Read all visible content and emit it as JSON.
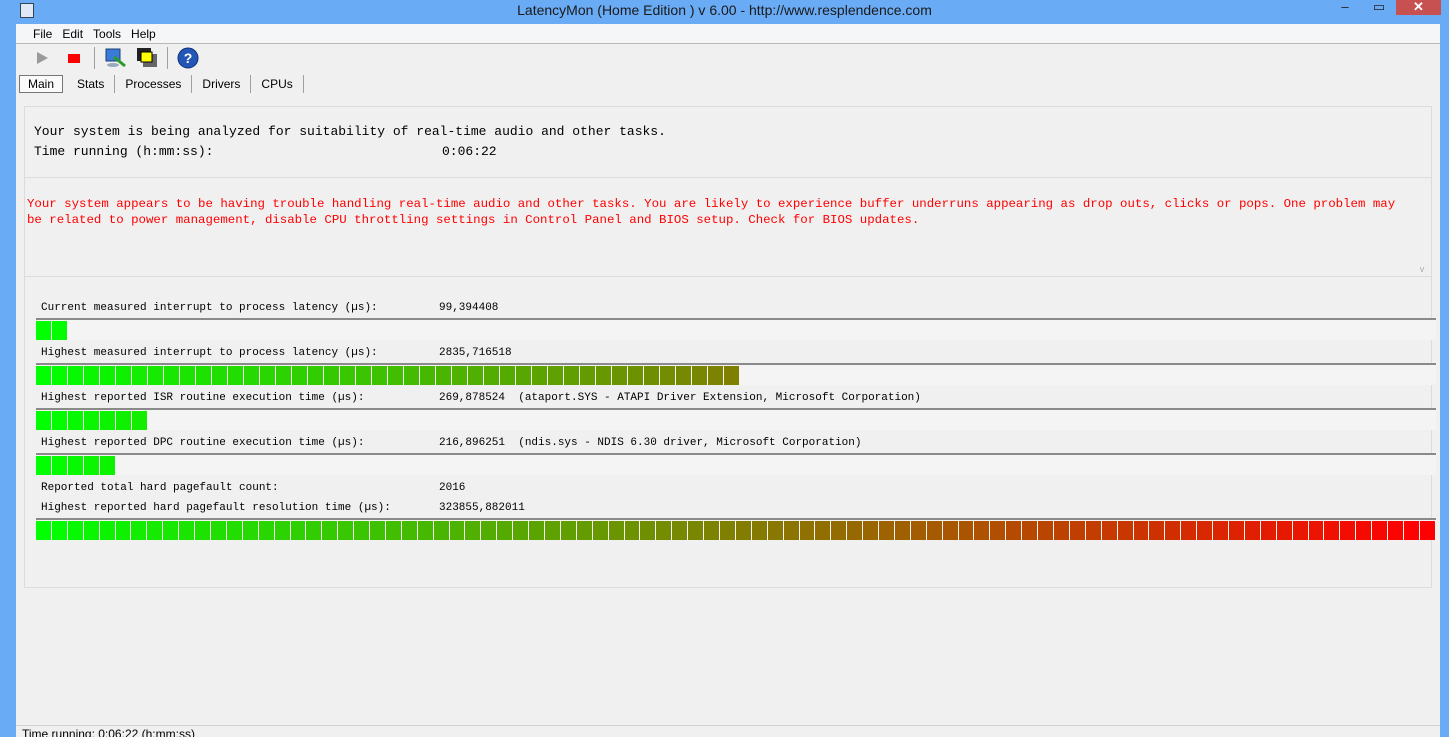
{
  "window": {
    "title": "LatencyMon  (Home Edition )  v 6.00 - http://www.resplendence.com",
    "minimize": "–",
    "maximize": "▭",
    "close": "✕"
  },
  "menu": [
    "File",
    "Edit",
    "Tools",
    "Help"
  ],
  "tabs": [
    "Main",
    "Stats",
    "Processes",
    "Drivers",
    "CPUs"
  ],
  "summary": {
    "line1": "Your system is being analyzed for suitability of real-time audio and other tasks.",
    "time_label": "Time running (h:mm:ss):",
    "time_value": "0:06:22"
  },
  "warning": "Your system appears to be having trouble handling real-time audio and other tasks. You are likely to experience buffer underruns appearing as drop outs, clicks or pops. One problem may be related to power management, disable CPU throttling settings in Control Panel and BIOS setup. Check for BIOS updates.",
  "metrics": [
    {
      "label": "Current measured interrupt to process latency (µs):",
      "value": "99,394408",
      "level": 0.023
    },
    {
      "label": "Highest measured interrupt to process latency (µs):",
      "value": "2835,716518",
      "level": 0.503
    },
    {
      "label": "Highest reported ISR routine execution time (µs):",
      "value": "269,878524  (ataport.SYS - ATAPI Driver Extension, Microsoft Corporation)",
      "level": 0.08
    },
    {
      "label": "Highest reported DPC routine execution time (µs):",
      "value": "216,896251  (ndis.sys - NDIS 6.30 driver, Microsoft Corporation)",
      "level": 0.057
    },
    {
      "label": "Reported total hard pagefault count:",
      "value": "2016"
    },
    {
      "label": "Highest reported hard pagefault resolution time (µs):",
      "value": "323855,882011",
      "level": 1.0
    }
  ],
  "status": "Time running: 0:06:22  (h:mm:ss)",
  "colors": {
    "warning": "#ff0000",
    "bar_start": "#00ff00",
    "bar_end": "#ff0000"
  }
}
